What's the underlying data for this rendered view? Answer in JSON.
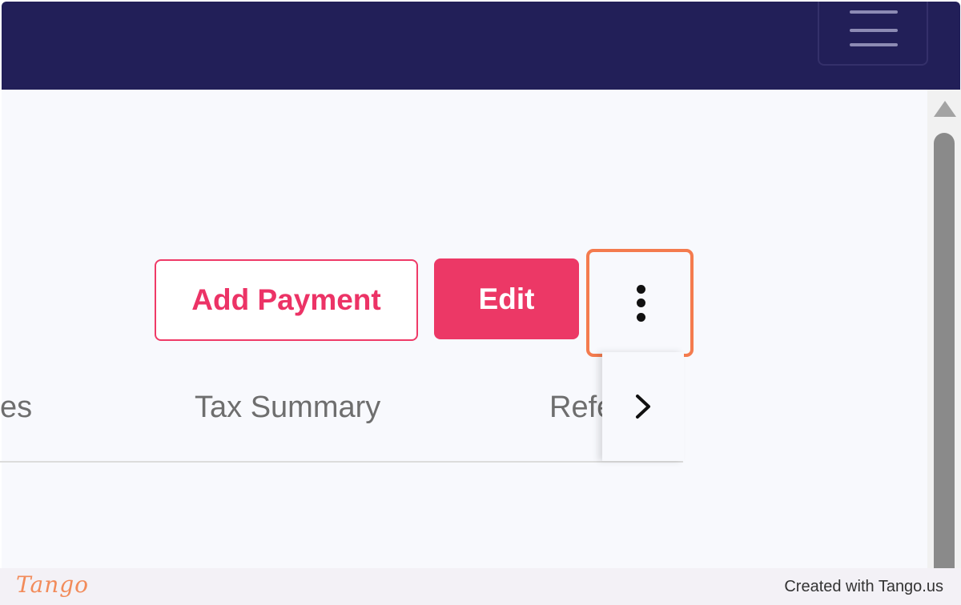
{
  "header": {
    "menu_icon": "hamburger-menu-icon",
    "background_color": "#221f58"
  },
  "actions": {
    "add_payment_label": "Add Payment",
    "edit_label": "Edit",
    "more_icon": "vertical-ellipsis-icon",
    "accent_color": "#ec3866",
    "highlight_color": "#f47b4e"
  },
  "tabs": {
    "items": [
      {
        "label": "es"
      },
      {
        "label": "Tax Summary"
      },
      {
        "label": "Refe"
      }
    ],
    "next_icon": "chevron-right-icon"
  },
  "scrollbar": {
    "up_icon": "scroll-up-arrow-icon"
  },
  "footer": {
    "logo_text": "Tango",
    "credit_text": "Created with Tango.us"
  }
}
